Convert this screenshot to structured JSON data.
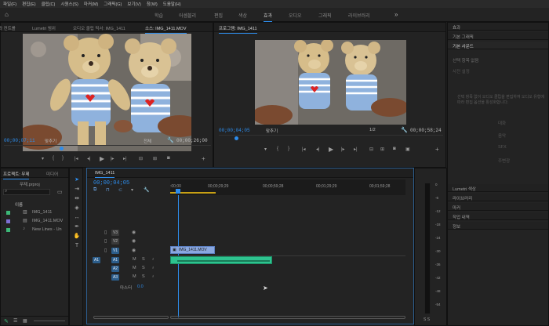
{
  "menu": [
    "파일(F)",
    "편집(E)",
    "클립(C)",
    "시퀀스(S)",
    "마커(M)",
    "그래픽(G)",
    "보기(V)",
    "창(W)",
    "도움말(H)"
  ],
  "workspaces": {
    "items": [
      "학습",
      "어셈블리",
      "편집",
      "색상",
      "효과",
      "오디오",
      "그래픽",
      "라이브러리"
    ],
    "active_index": 4,
    "overflow_icon": "»"
  },
  "source_monitor": {
    "tabs": [
      "효과 컨트롤",
      "Lumetri 범위",
      "오디오 클립 믹서: IMG_1411",
      "소스: IMG_1411.MOV"
    ],
    "timecode": "00;00;07;11",
    "fit": "맞추기",
    "quality": "전체",
    "duration": "00;00;26;00"
  },
  "program_monitor": {
    "tabs": [
      "프로그램: IMG_1411"
    ],
    "timecode": "00;00;04;05",
    "fit": "맞추기",
    "quality": "1/2",
    "duration": "00;00;58;24"
  },
  "project_panel": {
    "tabs": [
      "프로젝트: 무제",
      "미디어"
    ],
    "file": "무제.prproj",
    "column_header": "이름",
    "items": [
      {
        "name": "IMG_1411",
        "color": "#3cb878"
      },
      {
        "name": "IMG_1411.MOV",
        "color": "#7d6fd4"
      },
      {
        "name": "New Lines - Un",
        "color": "#3cb878"
      }
    ]
  },
  "timeline": {
    "tab": "IMG_1411",
    "timecode": "00;00;04;05",
    "ruler": [
      ":00;00",
      "00;00;29;29",
      "00;00;59;28",
      "00;01;29;29",
      "00;01;59;28"
    ],
    "video_tracks": [
      "V3",
      "V2",
      "V1"
    ],
    "audio_tracks": [
      "A1",
      "A2",
      "A3"
    ],
    "master_label": "마스터",
    "master_value": "0.0",
    "clip_name": "IMG_1411.MOV",
    "clip_color": "#8aa8e0",
    "audio_clip_color": "#2ec38f",
    "source_patch": "A1"
  },
  "right_panel": {
    "items": [
      "효과",
      "기본 그래픽",
      "기본 사운드"
    ],
    "sub": "선택 항목 없음",
    "preset_label": "사전 설정",
    "hint": "선택 항목 없이 오디오 클립을 편집하여 오디오 유형에 따라 편집 옵션을 활성화합니다.",
    "types": [
      "대화",
      "음악",
      "SFX",
      "주변광"
    ],
    "lower": [
      "Lumetri 색상",
      "라이브러리",
      "마커",
      "작업 내역",
      "정보"
    ]
  },
  "meter": {
    "labels": [
      "0",
      "-6",
      "-12",
      "-18",
      "-24",
      "-30",
      "-36",
      "-42",
      "-48",
      "-54"
    ],
    "footer": "S S"
  }
}
